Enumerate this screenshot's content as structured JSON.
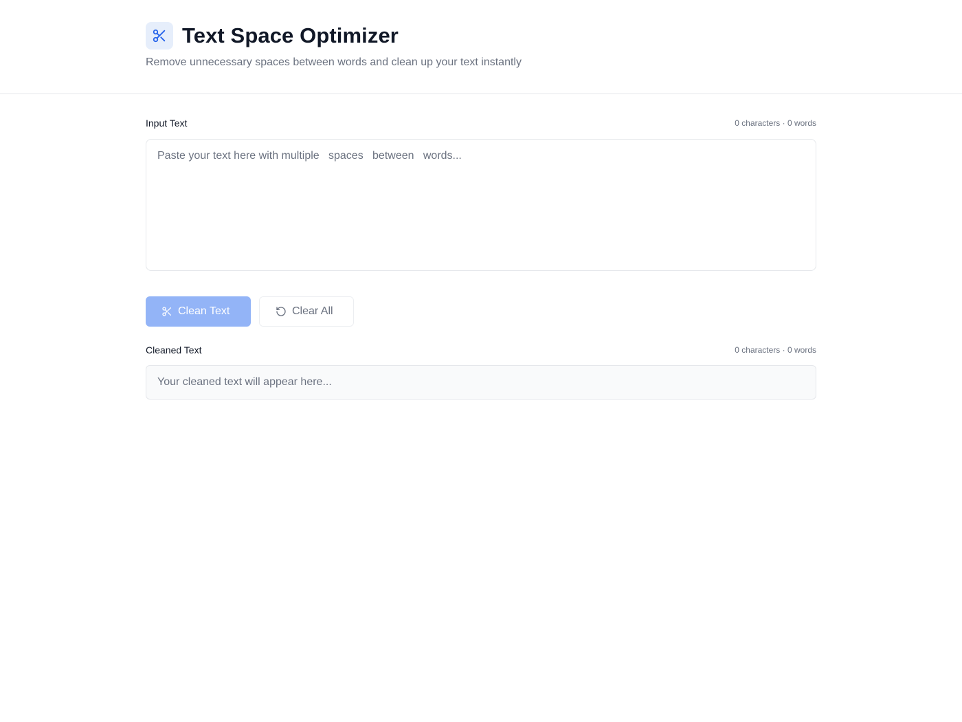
{
  "header": {
    "title": "Text Space Optimizer",
    "subtitle": "Remove unnecessary spaces between words and clean up your text instantly",
    "logo_icon": "scissors-icon"
  },
  "input": {
    "label": "Input Text",
    "counter": "0 characters · 0 words",
    "value": "",
    "placeholder": "Paste your text here with multiple   spaces   between   words..."
  },
  "actions": {
    "clean_label": "Clean Text",
    "clean_icon": "scissors-icon",
    "clear_label": "Clear All",
    "clear_icon": "rotate-ccw-icon"
  },
  "output": {
    "label": "Cleaned Text",
    "counter": "0 characters · 0 words",
    "placeholder": "Your cleaned text will appear here..."
  },
  "colors": {
    "accent": "#2563eb",
    "accent_disabled": "#93b4f7",
    "logo_bg": "#e6eefb",
    "muted_text": "#6b7280",
    "border": "#e5e7eb"
  }
}
